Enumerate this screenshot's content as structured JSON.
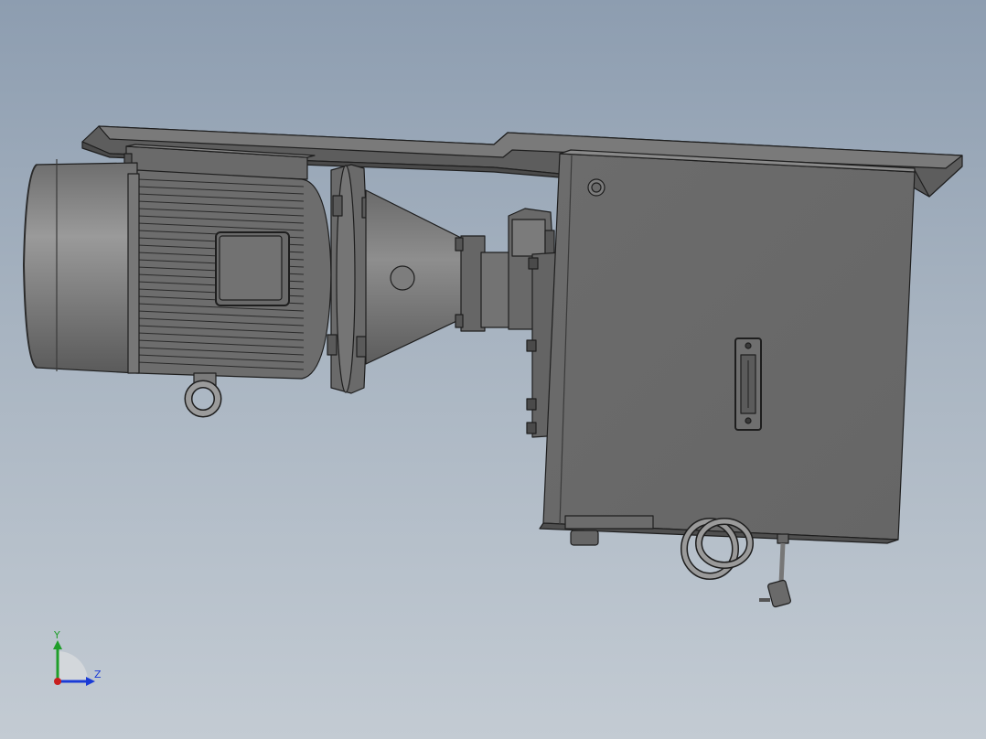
{
  "viewport": {
    "background_top": "#8d9db0",
    "background_bottom": "#c3cbd3"
  },
  "model": {
    "part_color": "#6b6b6b",
    "edge_color": "#1e1e1e"
  },
  "triad": {
    "y_label": "Y",
    "z_label": "Z",
    "y_color": "#1f9e2a",
    "z_color": "#1a3bd6",
    "x_color": "#c81e1e"
  }
}
